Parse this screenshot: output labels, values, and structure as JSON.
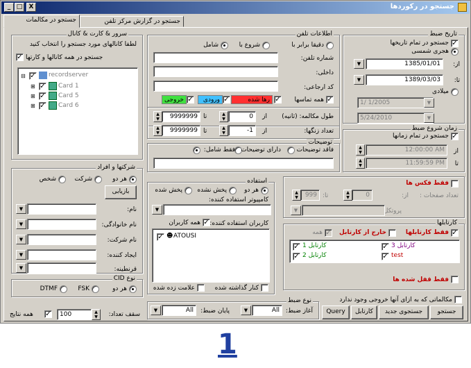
{
  "window": {
    "title": "جستجو در رکوردها",
    "min": "_",
    "max": "□",
    "close": "X"
  },
  "tabs": [
    "جستجو در مکالمات",
    "جستجو در گزارش مرکز تلفن"
  ],
  "dateGroup": {
    "title": "تاریخ ضبط",
    "allDates": "جستجو در تمام تاریخها",
    "hijri": "هجری شمسی",
    "from": "از:",
    "to": "تا:",
    "fromVal": "1385/01/01",
    "toVal": "1389/03/03",
    "miladi": "میلادی",
    "mFrom": "1/ 1/2005",
    "mTo": "5/24/2010"
  },
  "phoneGroup": {
    "title": "اطلاعات تلفن",
    "exact": "دقیقا برابر با",
    "starts": "شروع با",
    "contains": "شامل",
    "phone": "شماره تلفن:",
    "internal": "داخلی:",
    "ref": "کد ارجاعی:",
    "allCalls": "همه تماسها",
    "dropped": "رها شده",
    "incoming": "ورودی",
    "outgoing": "خروجی"
  },
  "serverGroup": {
    "title": "سرور & کارت & کانال",
    "instr": "لطفا کانالهای مورد جستجو را انتخاب کنید",
    "allChannels": "جستجو در همه کانالها و کارتها",
    "tree": {
      "root": "recordserver",
      "items": [
        "Card 1",
        "Card 5",
        "Card 6"
      ]
    }
  },
  "duration": {
    "len": "طول مکالمه: (ثانیه)",
    "from": "از",
    "to": "تا",
    "fromVal": "0",
    "toVal": "9999999",
    "rings": "تعداد زنگها:",
    "rFrom": "-1",
    "rTo": "9999999"
  },
  "desc": {
    "title": "توضیحات",
    "none": "فاقد توضیحات",
    "has": "دارای توضیحات",
    "only": "فقط شامل:"
  },
  "timeGroup": {
    "title": "زمان شروع ضبط",
    "all": "جستجو در تمام زمانها",
    "from": "از",
    "to": "تا",
    "fromVal": "12:00:00 AM",
    "toVal": "11:59:59 PM"
  },
  "companies": {
    "title": "شرکتها و افراد",
    "both": "هر دو",
    "company": "شرکت",
    "person": "شخص",
    "reload": "بازیابی",
    "name": "نام:",
    "family": "نام خانوادگی:",
    "companyName": "نام شرکت:",
    "creator": "ایجاد کننده:",
    "quarantine": "قرنطینه:"
  },
  "usage": {
    "title": "استفاده",
    "both": "هر دو",
    "notPlayed": "پخش نشده",
    "played": "پخش شده",
    "computer": "کامپیوتر استفاده کننده:",
    "users": "کاربران استفاده کننده:",
    "allUsers": "همه کاربران",
    "userItem": "ATOUSI",
    "shelved": "کنار گذاشته شده",
    "marked": "علامت زده شده"
  },
  "fax": {
    "only": "فقط فکس ها",
    "pages": "تعداد صفحات :",
    "from": "از:",
    "fromVal": "0",
    "to": "تا:",
    "toVal": "999",
    "protocol": "پروتکل:"
  },
  "cardboards": {
    "title": "کارتابلها",
    "only": "فقط کارتابلها",
    "outside": "خارج از کارتابل",
    "all": "همه",
    "items": [
      "کارتابل 3",
      "کارتابل 1",
      "test",
      "کارتابل 2"
    ],
    "lockedOnly": "فقط قفل شده ها"
  },
  "cid": {
    "title": "نوع CID",
    "both": "هر دو",
    "fsk": "FSK",
    "dtmf": "DTMF"
  },
  "bottom": {
    "noOut": "مکالماتی که به ازای آنها خروجی وجود ندارد",
    "search": "جستجو",
    "newSearch": "جستجوی جدید",
    "cardboard": "کارتابل",
    "query": "Query",
    "recType": "نوع ضبط",
    "startRec": "آغاز ضبط:",
    "endRec": "پایان ضبط:",
    "all1": "All",
    "all2": "All",
    "limit": "سقف تعداد:",
    "limitVal": "100",
    "allResults": "همه نتایج"
  },
  "footer": {
    "number": "1"
  }
}
